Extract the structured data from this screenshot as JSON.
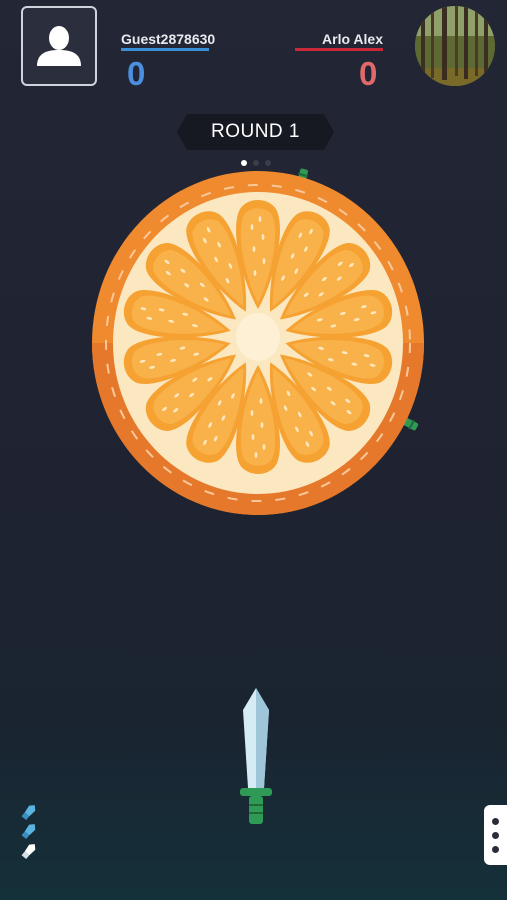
{
  "player": {
    "name": "Guest2878630",
    "score": "0",
    "color": "#3a8fd8",
    "avatar_icon": "user-silhouette-icon"
  },
  "opponent": {
    "name": "Arlo Alex",
    "score": "0",
    "color": "#c8283a",
    "avatar_icon": "forest-photo-avatar"
  },
  "round": {
    "label": "ROUND 1",
    "current_stage": 1,
    "total_stages": 3
  },
  "target": {
    "type": "orange-slice",
    "stuck_knives": 2
  },
  "knives_remaining": 3,
  "menu_icon": "more-vertical-icon",
  "colors": {
    "background": "#222533",
    "orange_rind": "#f08a2e",
    "segment": "#f6a232",
    "knife_blade": "#d6ecf5",
    "knife_handle": "#2e9a55"
  }
}
